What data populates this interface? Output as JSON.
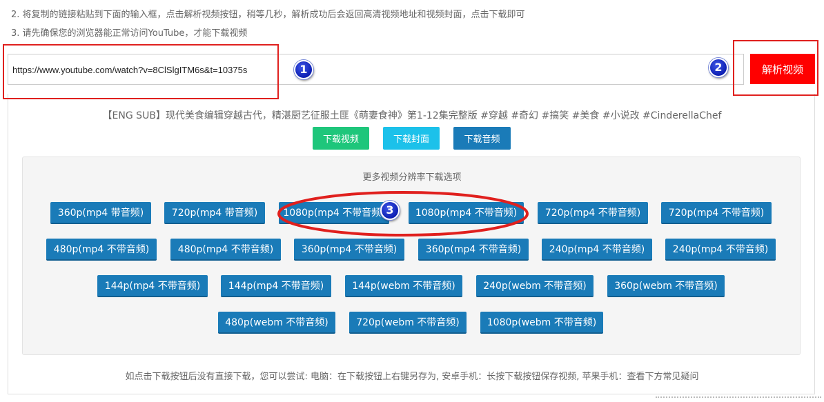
{
  "instructions": {
    "step2": "2. 将复制的链接粘贴到下面的输入框，点击解析视频按钮，稍等几秒，解析成功后会返回高清视频地址和视频封面，点击下载即可",
    "step3": "3. 请先确保您的浏览器能正常访问YouTube，才能下载视频"
  },
  "url_input": {
    "value": "https://www.youtube.com/watch?v=8ClSlgITM6s&t=10375s"
  },
  "parse_button_label": "解析视频",
  "annotations": {
    "badge1": "1",
    "badge2": "2",
    "badge3": "3",
    "highlight_color": "#e0201e"
  },
  "video_title": "【ENG SUB】现代美食编辑穿越古代，精湛厨艺征服土匪《萌妻食神》第1-12集完整版 #穿越 #奇幻 #搞笑 #美食 #小说改 #CinderellaChef",
  "download_buttons": {
    "video": "下载视频",
    "cover": "下载封面",
    "audio": "下载音频"
  },
  "resolutions": {
    "title": "更多视频分辨率下载选项",
    "rows": [
      [
        "360p(mp4 带音频)",
        "720p(mp4 带音频)",
        "1080p(mp4 不带音频)",
        "1080p(mp4 不带音频)",
        "720p(mp4 不带音频)",
        "720p(mp4 不带音频)"
      ],
      [
        "480p(mp4 不带音频)",
        "480p(mp4 不带音频)",
        "360p(mp4 不带音频)",
        "360p(mp4 不带音频)",
        "240p(mp4 不带音频)",
        "240p(mp4 不带音频)"
      ],
      [
        "144p(mp4 不带音频)",
        "144p(mp4 不带音频)",
        "144p(webm 不带音频)",
        "240p(webm 不带音频)",
        "360p(webm 不带音频)"
      ],
      [
        "480p(webm 不带音频)",
        "720p(webm 不带音频)",
        "1080p(webm 不带音频)"
      ]
    ]
  },
  "footer_note": "如点击下载按钮后没有直接下载，您可以尝试: 电脑：在下载按钮上右键另存为, 安卓手机：长按下载按钮保存视频, 苹果手机：查看下方常见疑问",
  "colors": {
    "parse_button": "#ff0000",
    "download_video": "#1ec67b",
    "download_cover": "#1cc1ea",
    "download_audio": "#1a7bb8",
    "resolution_button": "#1a7bb8"
  }
}
